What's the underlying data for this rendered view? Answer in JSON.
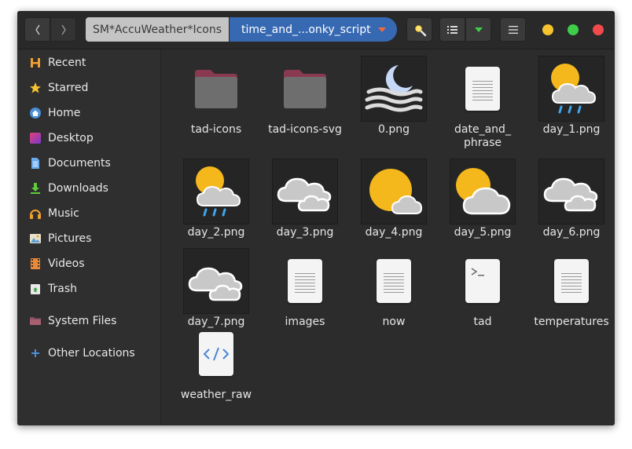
{
  "breadcrumb": {
    "parent": "SM*AccuWeather*Icons",
    "current": "time_and_...onky_script"
  },
  "sidebar": {
    "items": [
      {
        "label": "Recent",
        "icon": "recent-icon"
      },
      {
        "label": "Starred",
        "icon": "star-icon"
      },
      {
        "label": "Home",
        "icon": "home-icon"
      },
      {
        "label": "Desktop",
        "icon": "desktop-icon"
      },
      {
        "label": "Documents",
        "icon": "documents-icon"
      },
      {
        "label": "Downloads",
        "icon": "downloads-icon"
      },
      {
        "label": "Music",
        "icon": "music-icon"
      },
      {
        "label": "Pictures",
        "icon": "pictures-icon"
      },
      {
        "label": "Videos",
        "icon": "videos-icon"
      },
      {
        "label": "Trash",
        "icon": "trash-icon"
      },
      {
        "label": "System Files",
        "icon": "drive-icon"
      },
      {
        "label": "Other Locations",
        "icon": "plus-icon"
      }
    ]
  },
  "files": [
    {
      "name": "tad-icons",
      "kind": "folder"
    },
    {
      "name": "tad-icons-svg",
      "kind": "folder"
    },
    {
      "name": "0.png",
      "kind": "moon-clouds"
    },
    {
      "name": "date_and_\nphrase",
      "kind": "text"
    },
    {
      "name": "day_1.png",
      "kind": "sun-cloud-rain"
    },
    {
      "name": "day_2.png",
      "kind": "sun-cloud-rain"
    },
    {
      "name": "day_3.png",
      "kind": "clouds"
    },
    {
      "name": "day_4.png",
      "kind": "sun-big-cloud"
    },
    {
      "name": "day_5.png",
      "kind": "sun-cloud"
    },
    {
      "name": "day_6.png",
      "kind": "clouds"
    },
    {
      "name": "day_7.png",
      "kind": "clouds"
    },
    {
      "name": "images",
      "kind": "text"
    },
    {
      "name": "now",
      "kind": "text"
    },
    {
      "name": "tad",
      "kind": "script"
    },
    {
      "name": "temperatures",
      "kind": "text"
    },
    {
      "name": "weather_raw",
      "kind": "code"
    }
  ],
  "colors": {
    "accent": "#3769b3",
    "folder": "#7a5060",
    "sun": "#f5b81c",
    "cloud": "#c8c8c8",
    "rain": "#3fa6ee",
    "moon": "#c6d9f7"
  }
}
